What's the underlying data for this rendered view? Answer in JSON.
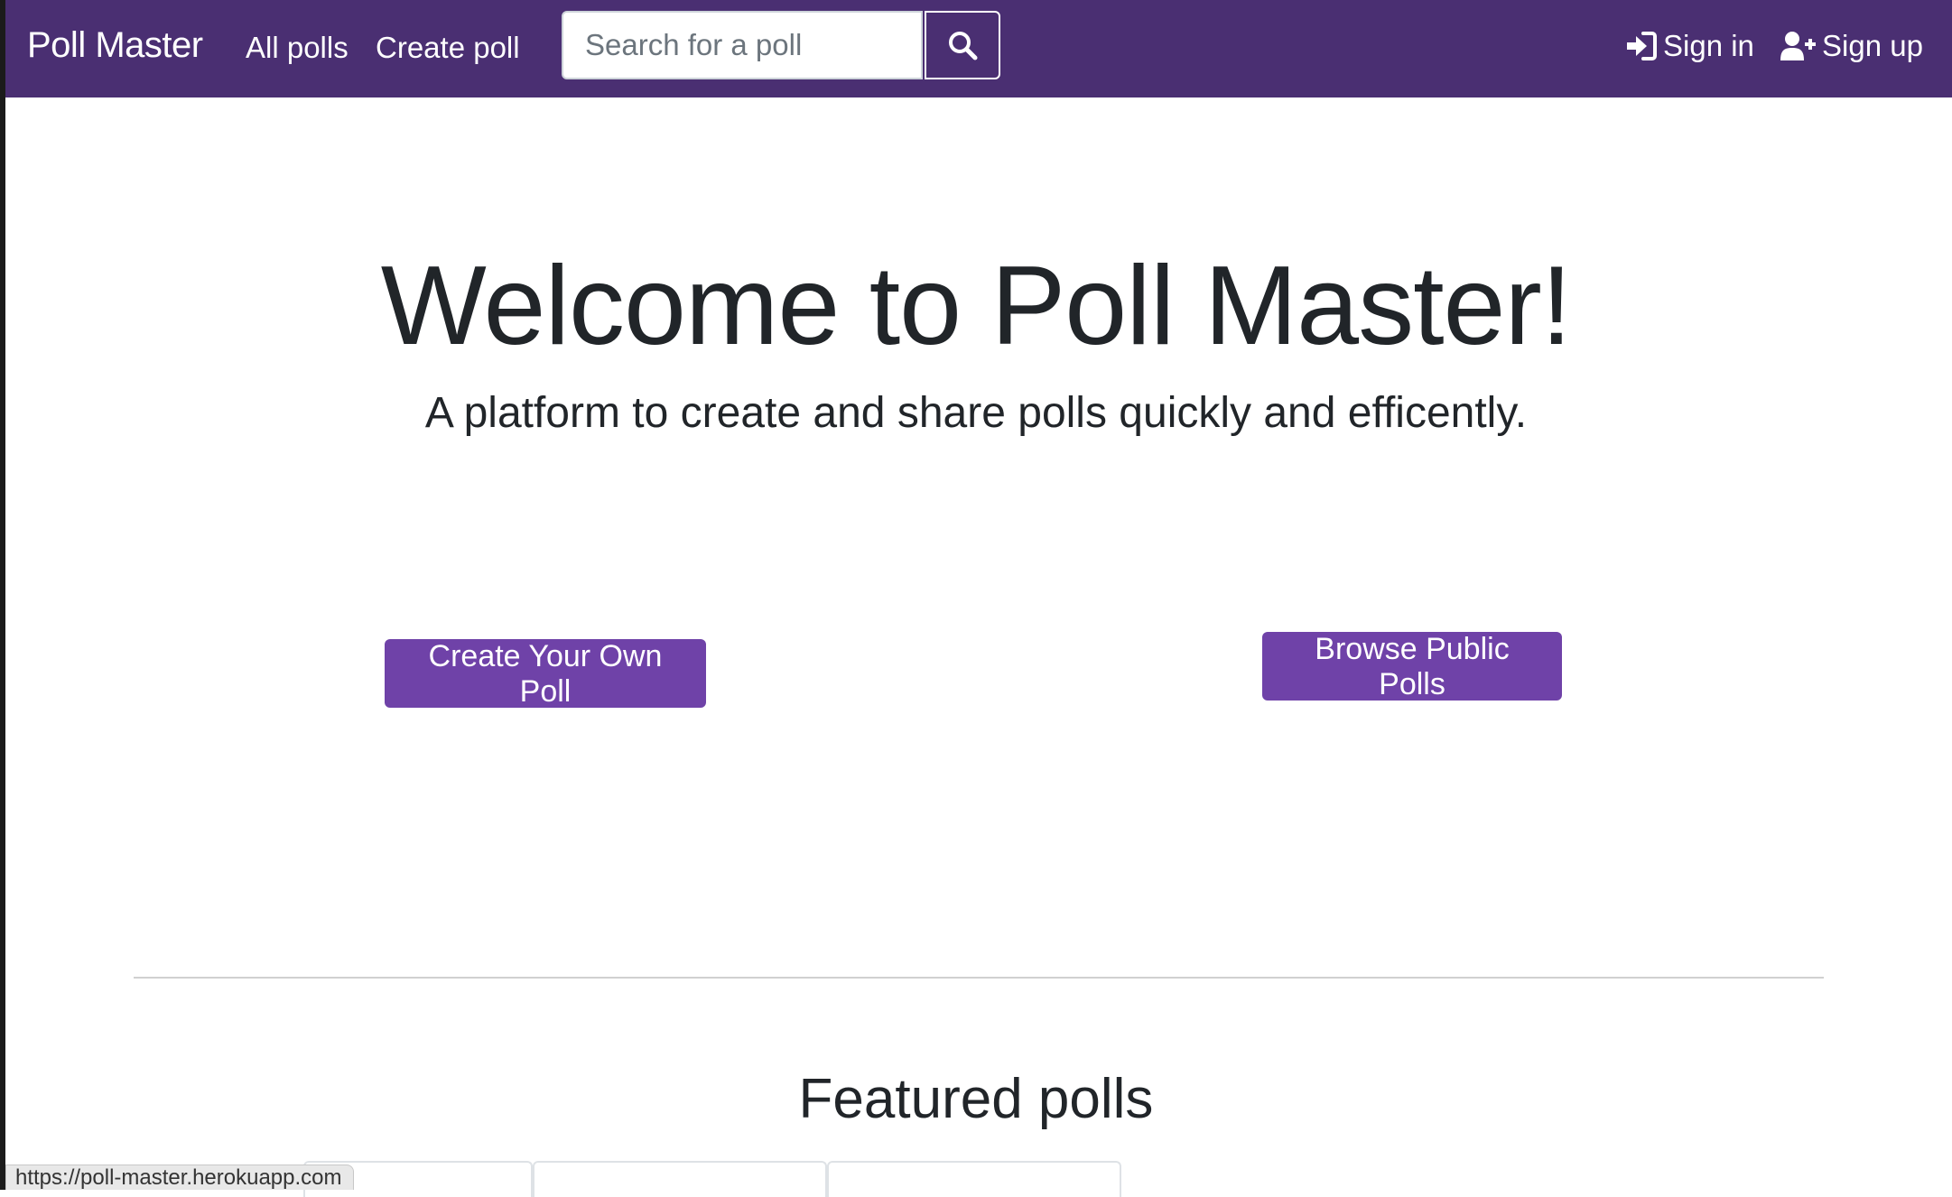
{
  "colors": {
    "navbar_bg": "#4a2f72",
    "primary_button": "#6f42a8",
    "text_dark": "#212529"
  },
  "navbar": {
    "brand": "Poll Master",
    "links": [
      {
        "label": "All polls"
      },
      {
        "label": "Create poll"
      }
    ],
    "search": {
      "placeholder": "Search for a poll",
      "value": "",
      "button_icon": "search-icon"
    },
    "sign_in": {
      "label": "Sign in",
      "icon": "sign-in-icon"
    },
    "sign_up": {
      "label": "Sign up",
      "icon": "user-plus-icon"
    }
  },
  "hero": {
    "title": "Welcome to Poll Master!",
    "subtitle": "A platform to create and share polls quickly and efficently.",
    "create_button": "Create Your Own Poll",
    "browse_button": "Browse Public Polls"
  },
  "featured": {
    "title": "Featured polls",
    "tabs": [
      {
        "label": "..."
      },
      {
        "label": "..."
      },
      {
        "label": "..."
      }
    ]
  },
  "status_bar": {
    "url": "https://poll-master.herokuapp.com"
  }
}
